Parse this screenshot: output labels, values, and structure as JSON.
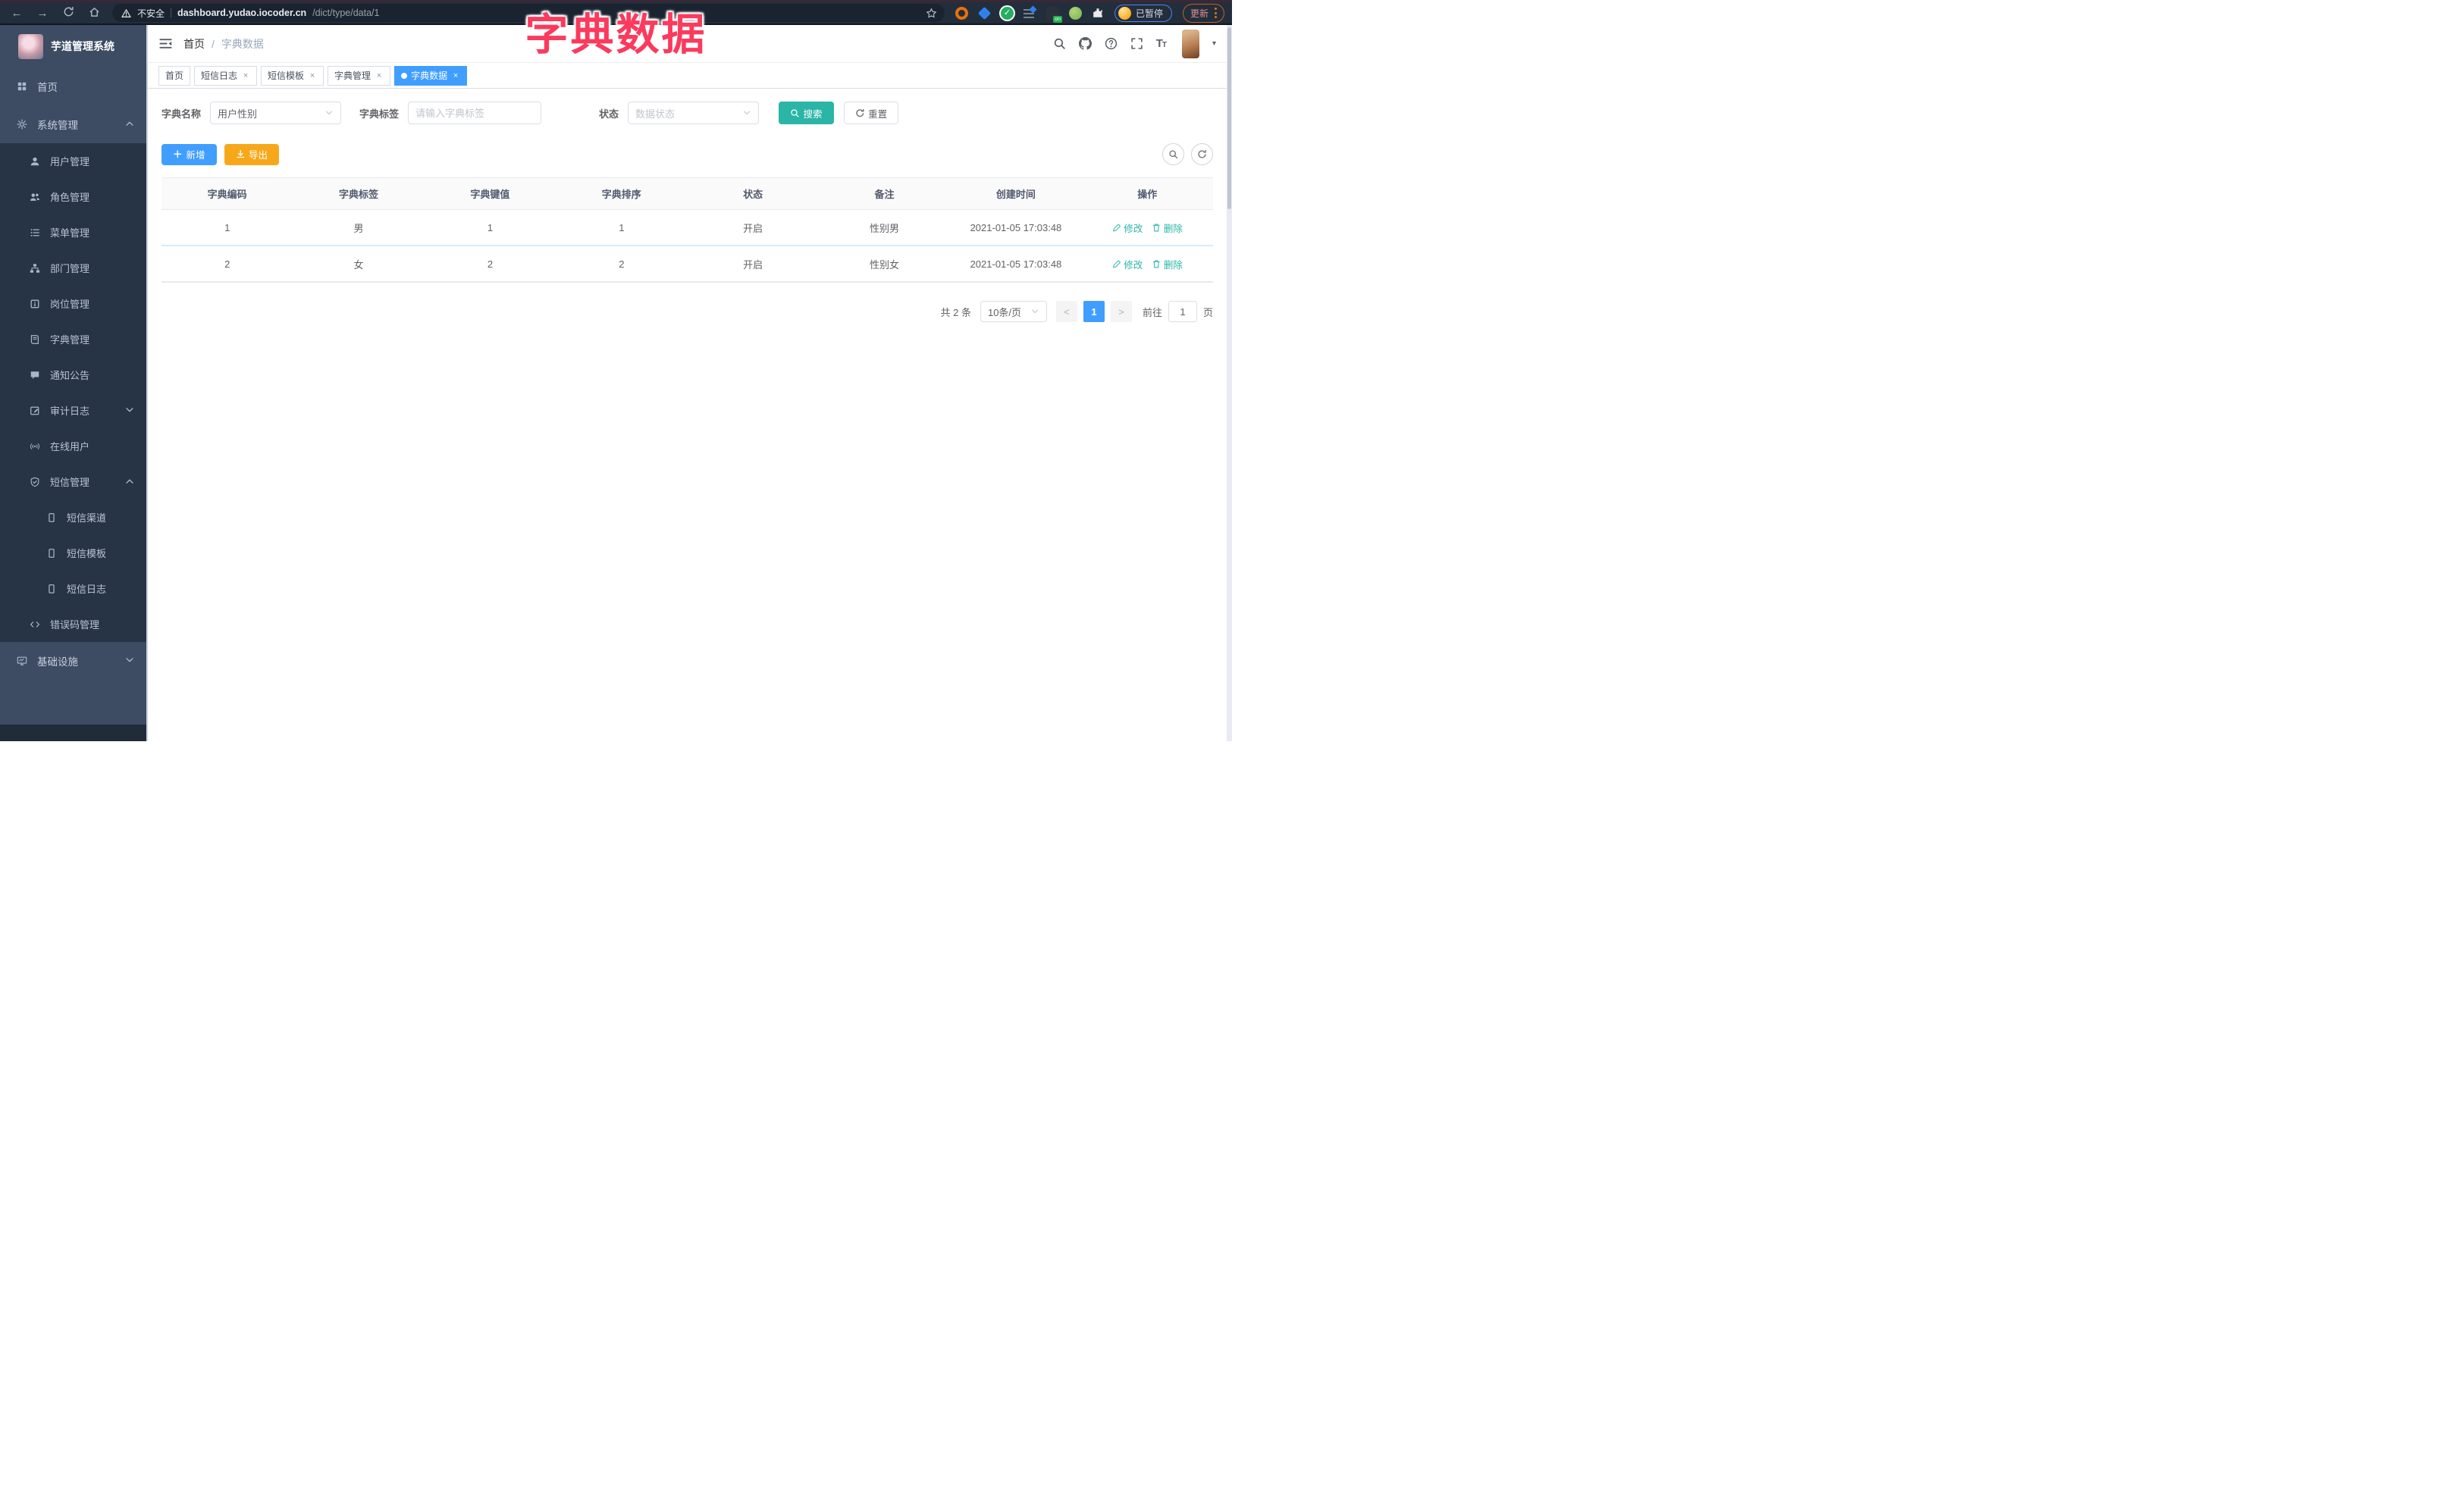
{
  "overlay_title": "字典数据",
  "browser": {
    "security_label": "不安全",
    "url_host": "dashboard.yudao.iocoder.cn",
    "url_path": "/dict/type/data/1",
    "paused_badge": "已暂停",
    "update_button": "更新"
  },
  "sidebar": {
    "app_title": "芋道管理系统",
    "items": [
      {
        "label": "首页"
      },
      {
        "label": "系统管理"
      },
      {
        "label": "用户管理"
      },
      {
        "label": "角色管理"
      },
      {
        "label": "菜单管理"
      },
      {
        "label": "部门管理"
      },
      {
        "label": "岗位管理"
      },
      {
        "label": "字典管理"
      },
      {
        "label": "通知公告"
      },
      {
        "label": "审计日志"
      },
      {
        "label": "在线用户"
      },
      {
        "label": "短信管理"
      },
      {
        "label": "短信渠道"
      },
      {
        "label": "短信模板"
      },
      {
        "label": "短信日志"
      },
      {
        "label": "错误码管理"
      },
      {
        "label": "基础设施"
      }
    ]
  },
  "breadcrumb": {
    "home": "首页",
    "separator": "/",
    "current": "字典数据"
  },
  "tabs": [
    {
      "label": "首页"
    },
    {
      "label": "短信日志"
    },
    {
      "label": "短信模板"
    },
    {
      "label": "字典管理"
    },
    {
      "label": "字典数据"
    }
  ],
  "filters": {
    "dict_name_label": "字典名称",
    "dict_name_value": "用户性别",
    "dict_label_label": "字典标签",
    "dict_label_placeholder": "请输入字典标签",
    "status_label": "状态",
    "status_placeholder": "数据状态",
    "search_button": "搜索",
    "reset_button": "重置"
  },
  "toolbar": {
    "add_button": "新增",
    "export_button": "导出"
  },
  "table": {
    "columns": [
      "字典编码",
      "字典标签",
      "字典键值",
      "字典排序",
      "状态",
      "备注",
      "创建时间",
      "操作"
    ],
    "rows": [
      [
        "1",
        "男",
        "1",
        "1",
        "开启",
        "性别男",
        "2021-01-05 17:03:48"
      ],
      [
        "2",
        "女",
        "2",
        "2",
        "开启",
        "性别女",
        "2021-01-05 17:03:48"
      ]
    ],
    "actions": {
      "edit": "修改",
      "delete": "删除"
    }
  },
  "pagination": {
    "total_label": "共 2 条",
    "page_size": "10条/页",
    "prev": "<",
    "page": "1",
    "next": ">",
    "goto_label": "前往",
    "goto_value": "1",
    "unit_label": "页"
  },
  "colors": {
    "primary": "#409eff",
    "search_teal": "#2bb5a7",
    "export_orange": "#f7a81a",
    "overlay_pink": "#fb3a5d",
    "sidebar_bg": "#3d4b63",
    "sidebar_submenu_bg": "#263445"
  }
}
